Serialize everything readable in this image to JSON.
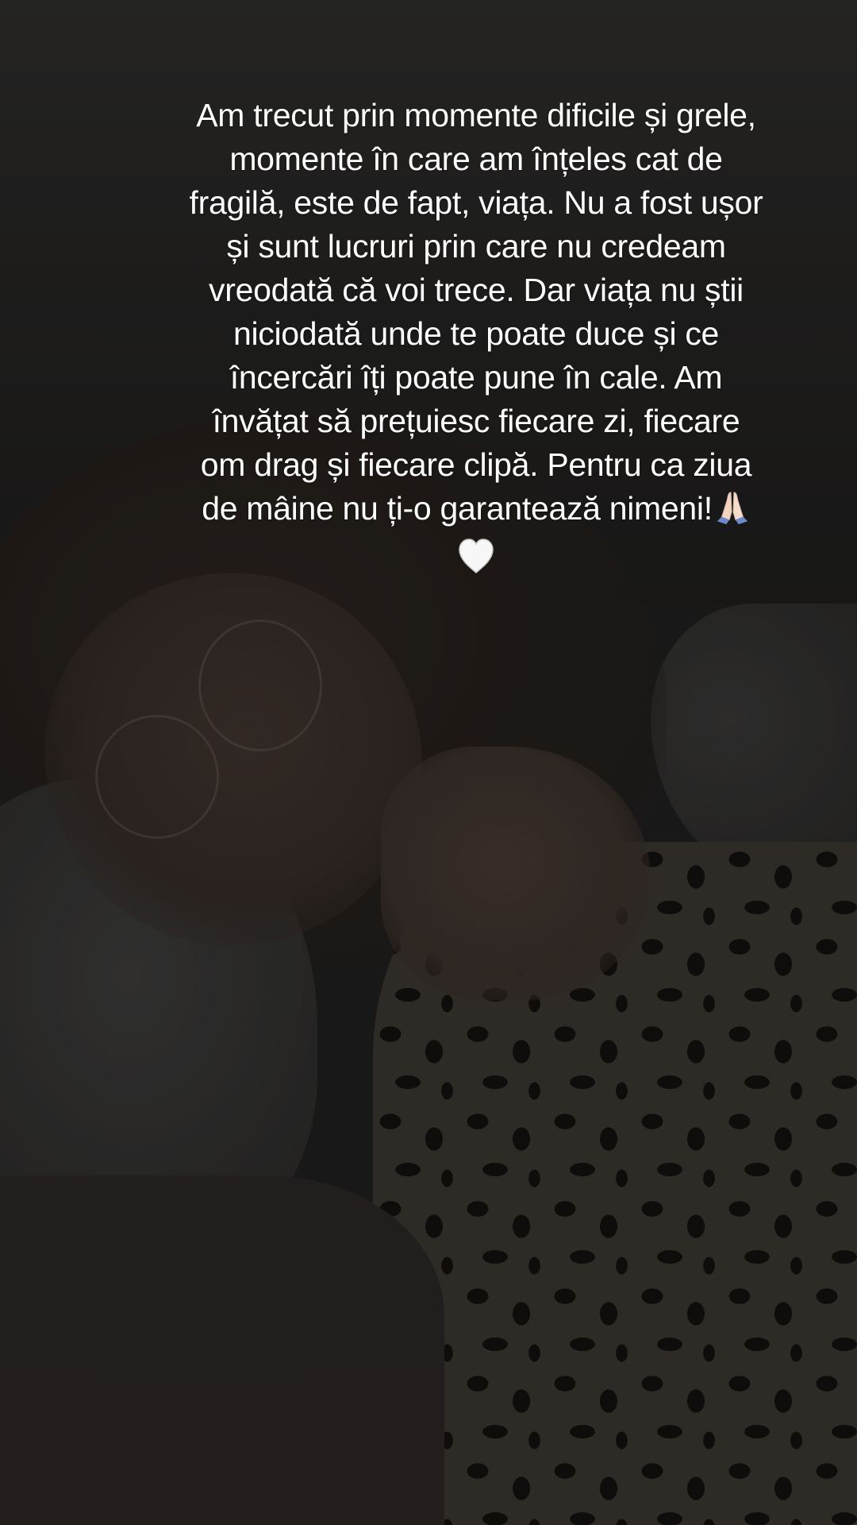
{
  "caption": {
    "lines": [
      "Am trecut prin momente dificile și grele,",
      "momente în care am înțeles cat de",
      "fragilă, este de fapt, viața. Nu a fost ușor",
      "și sunt lucruri prin care nu credeam",
      "vreodată că voi trece. Dar viața nu știi",
      "niciodată unde te poate duce și ce",
      "încercări îți poate pune în cale. Am",
      "învățat să prețuiesc fiecare zi, fiecare",
      "om drag și fiecare clipă. Pentru ca ziua",
      "de mâine nu ți-o garantează nimeni!"
    ],
    "trailing_icons": [
      "folded-hands-icon",
      "white-heart-icon"
    ]
  },
  "colors": {
    "text": "#ffffff",
    "background_tint": "#1e1d1c"
  }
}
